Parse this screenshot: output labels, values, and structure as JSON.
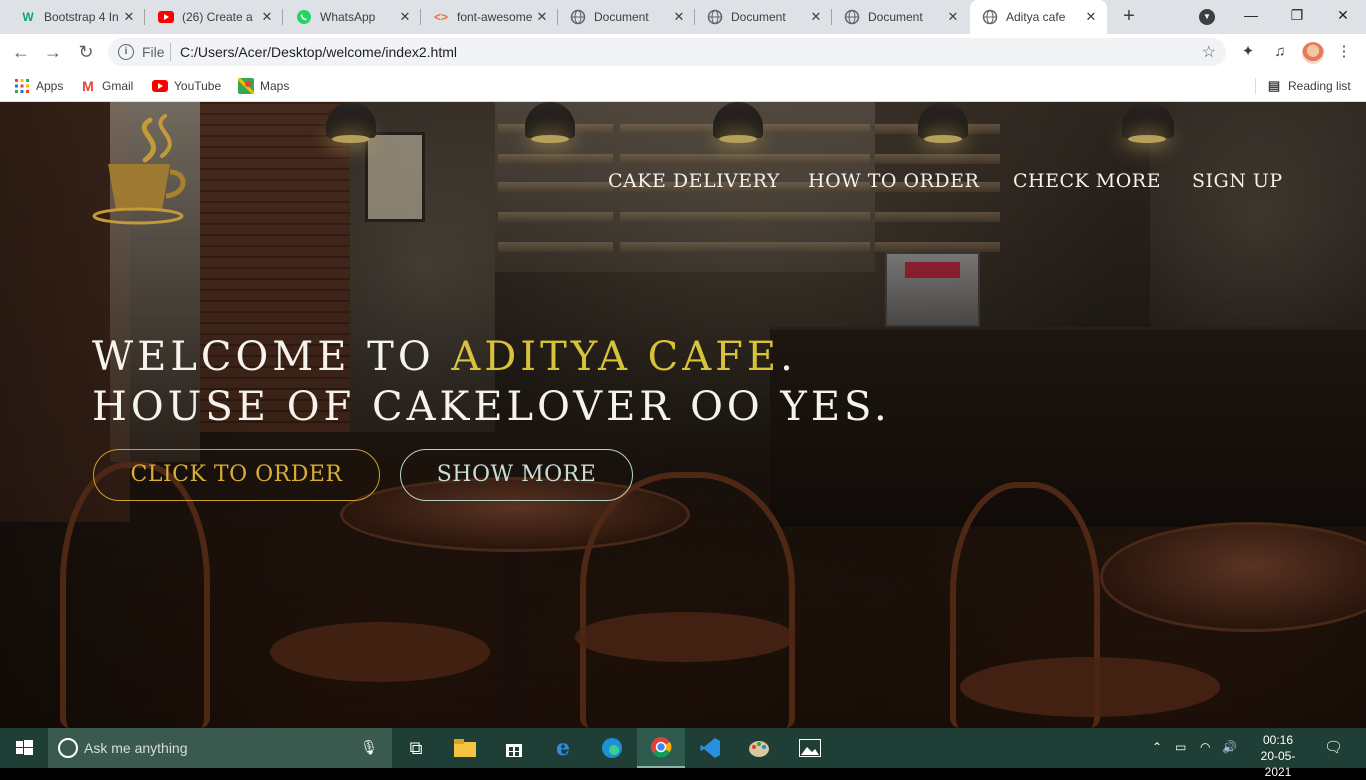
{
  "browser": {
    "tabs": [
      {
        "title": "Bootstrap 4 In",
        "icon": "w3schools-icon",
        "color": "#04aa6d"
      },
      {
        "title": "(26) Create a",
        "icon": "youtube-icon",
        "color": "#ff0000"
      },
      {
        "title": "WhatsApp",
        "icon": "whatsapp-icon",
        "color": "#25d366"
      },
      {
        "title": "font-awesome",
        "icon": "code-icon",
        "color": "#e8703a"
      },
      {
        "title": "Document",
        "icon": "globe-icon",
        "color": "#5f6368"
      },
      {
        "title": "Document",
        "icon": "globe-icon",
        "color": "#5f6368"
      },
      {
        "title": "Document",
        "icon": "globe-icon",
        "color": "#5f6368"
      },
      {
        "title": "Aditya cafe",
        "icon": "globe-icon",
        "color": "#5f6368",
        "active": true
      }
    ],
    "address": {
      "scheme_label": "File",
      "url": "C:/Users/Acer/Desktop/welcome/index2.html"
    },
    "bookmarks": [
      {
        "label": "Apps",
        "icon": "apps-grid-icon"
      },
      {
        "label": "Gmail",
        "icon": "gmail-icon"
      },
      {
        "label": "YouTube",
        "icon": "youtube-icon"
      },
      {
        "label": "Maps",
        "icon": "maps-icon"
      }
    ],
    "reading_list": "Reading list"
  },
  "site": {
    "nav": [
      "CAKE DELIVERY",
      "HOW TO ORDER",
      "CHECK MORE",
      "SIGN UP"
    ],
    "hero_line1_prefix": "WELCOME TO ",
    "hero_line1_accent": "ADITYA CAFE",
    "hero_line1_suffix": ".",
    "hero_line2": "HOUSE OF CAKELOVER OO YES.",
    "btn_order": "CLICK TO ORDER",
    "btn_more": "SHOW MORE",
    "accent_color": "#d8c23a"
  },
  "taskbar": {
    "search_placeholder": "Ask me anything",
    "time": "00:16",
    "date": "20-05-2021"
  }
}
